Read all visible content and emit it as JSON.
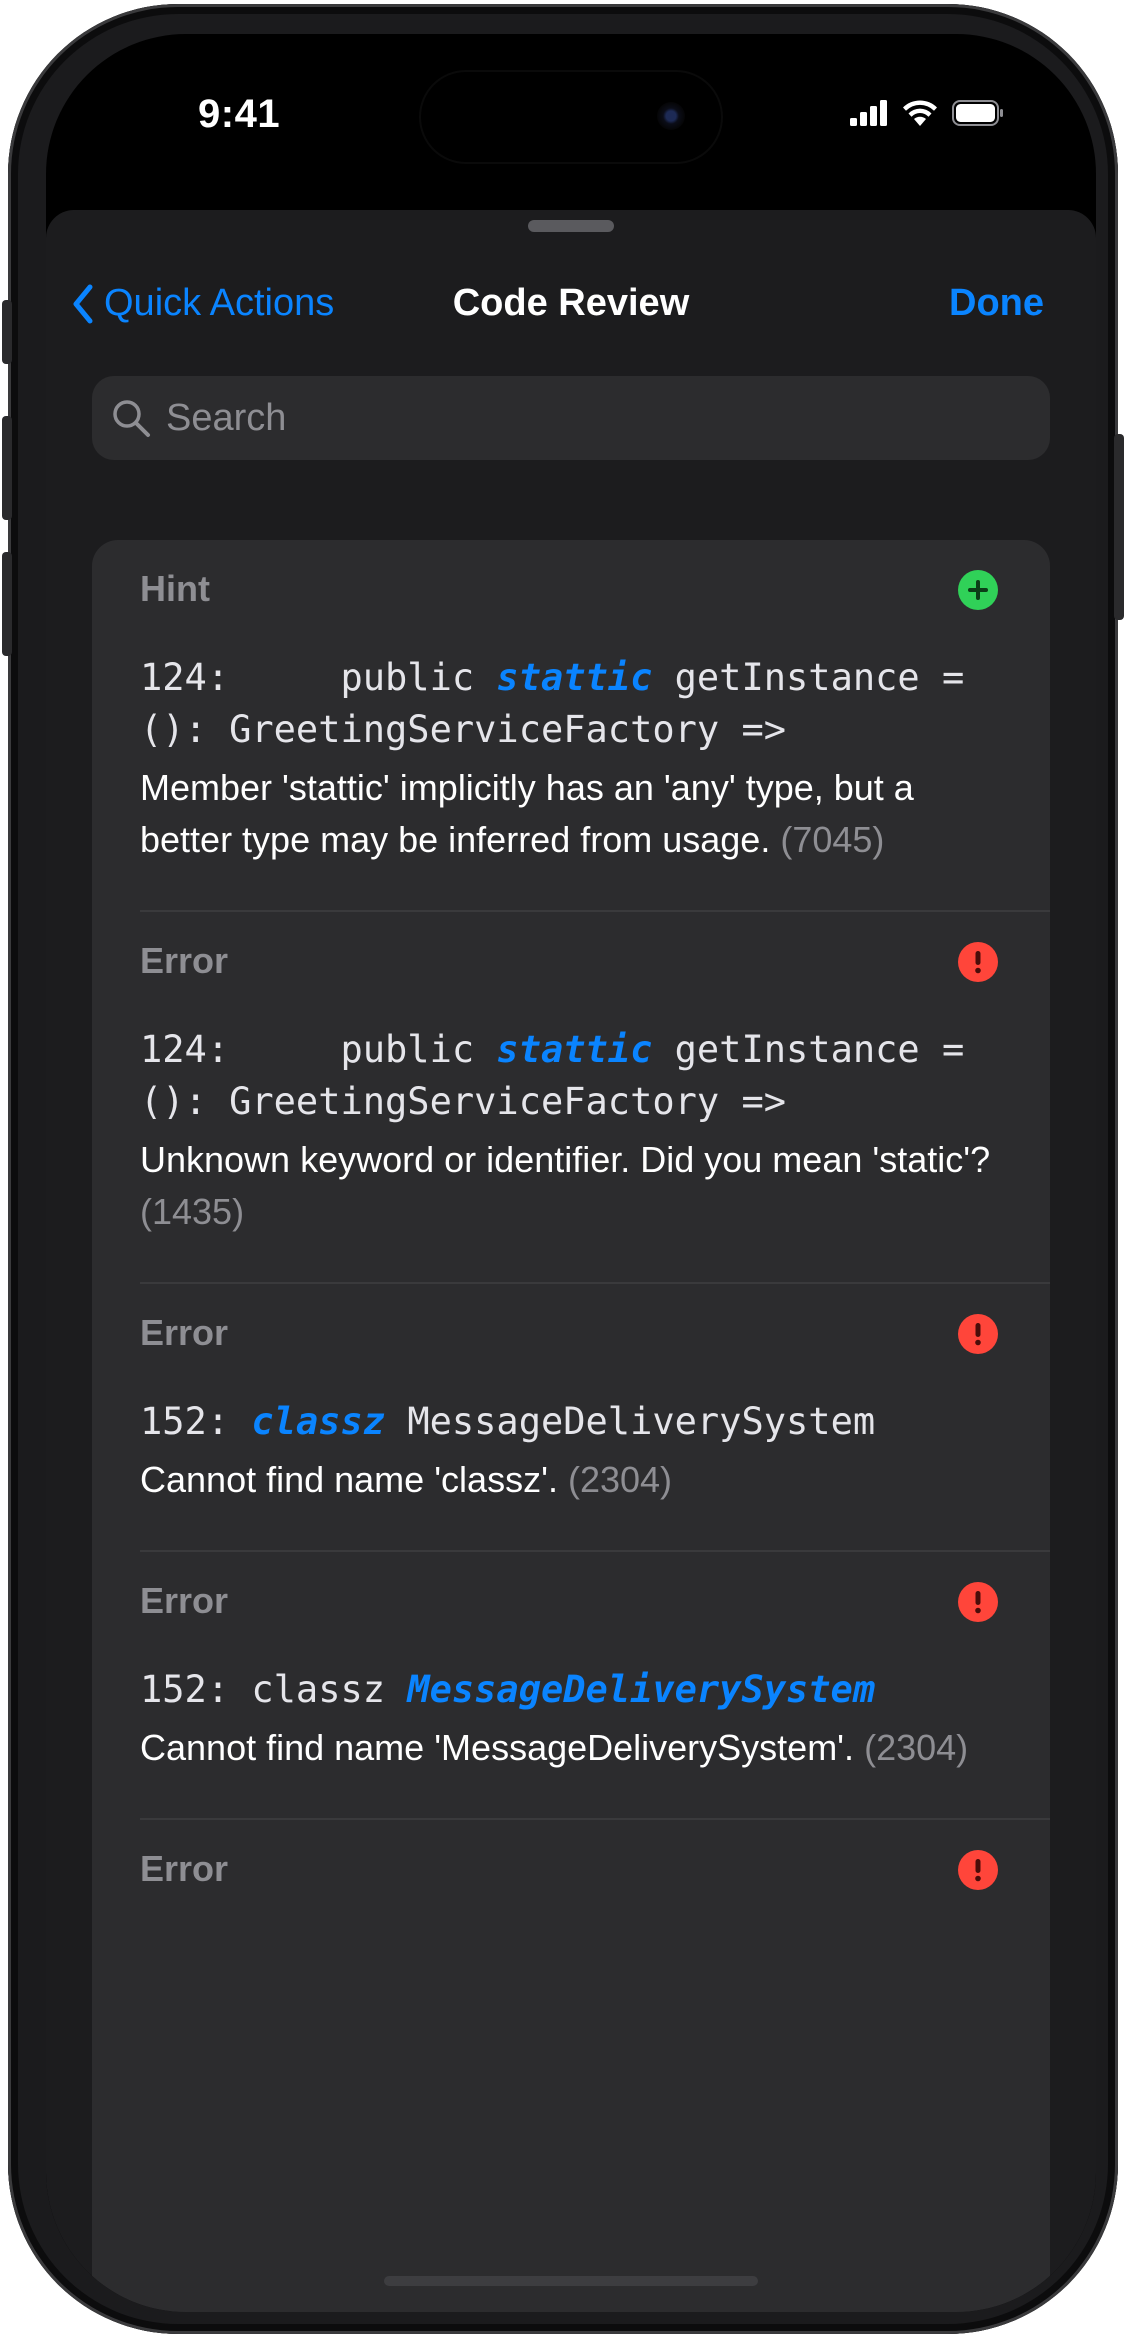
{
  "status_bar": {
    "time": "9:41"
  },
  "nav": {
    "back_label": "Quick Actions",
    "title": "Code Review",
    "done_label": "Done"
  },
  "search": {
    "placeholder": "Search",
    "value": ""
  },
  "items": [
    {
      "label": "Hint",
      "badge": "+",
      "badge_icon": "plus-circle-icon",
      "badge_color": "#30d158",
      "code_before": "124:     public ",
      "code_highlight": "stattic",
      "code_after": " getInstance = (): GreetingServiceFactory =>",
      "message": "Member 'stattic' implicitly has an 'any' type, but a better type may be inferred from usage.",
      "code_num": "(7045)"
    },
    {
      "label": "Error",
      "badge": "!",
      "badge_icon": "exclamation-circle-icon",
      "badge_color": "#ff453a",
      "code_before": "124:     public ",
      "code_highlight": "stattic",
      "code_after": " getInstance = (): GreetingServiceFactory =>",
      "message": "Unknown keyword or identifier. Did you mean 'static'?",
      "code_num": "(1435)"
    },
    {
      "label": "Error",
      "badge": "!",
      "badge_icon": "exclamation-circle-icon",
      "badge_color": "#ff453a",
      "code_before": "152: ",
      "code_highlight": "classz",
      "code_after": " MessageDeliverySystem",
      "message": "Cannot find name 'classz'.",
      "code_num": "(2304)"
    },
    {
      "label": "Error",
      "badge": "!",
      "badge_icon": "exclamation-circle-icon",
      "badge_color": "#ff453a",
      "code_before": "152: classz ",
      "code_highlight": "MessageDeliverySystem",
      "code_after": "",
      "message": "Cannot find name 'MessageDeliverySystem'.",
      "code_num": "(2304)"
    },
    {
      "label": "Error",
      "badge": "!",
      "badge_icon": "exclamation-circle-icon",
      "badge_color": "#ff453a"
    }
  ]
}
